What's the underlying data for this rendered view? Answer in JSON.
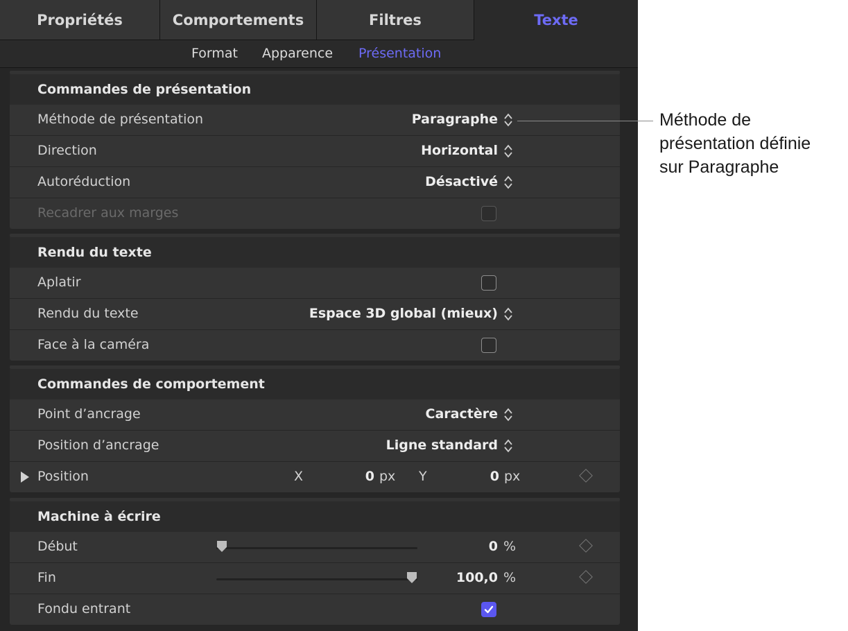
{
  "tabs": [
    {
      "label": "Propriétés"
    },
    {
      "label": "Comportements"
    },
    {
      "label": "Filtres"
    },
    {
      "label": "Texte"
    }
  ],
  "subtabs": [
    {
      "label": "Format"
    },
    {
      "label": "Apparence"
    },
    {
      "label": "Présentation"
    }
  ],
  "layout_controls": {
    "header": "Commandes de présentation",
    "method": {
      "label": "Méthode de présentation",
      "value": "Paragraphe"
    },
    "direction": {
      "label": "Direction",
      "value": "Horizontal"
    },
    "auto_shrink": {
      "label": "Autoréduction",
      "value": "Désactivé"
    },
    "reframe": {
      "label": "Recadrer aux marges",
      "checked": false
    }
  },
  "text_rendering": {
    "header": "Rendu du texte",
    "flatten": {
      "label": "Aplatir",
      "checked": false
    },
    "render": {
      "label": "Rendu du texte",
      "value": "Espace 3D global (mieux)"
    },
    "face_camera": {
      "label": "Face à la caméra",
      "checked": false
    }
  },
  "behavior_controls": {
    "header": "Commandes de comportement",
    "anchor_point": {
      "label": "Point d’ancrage",
      "value": "Caractère"
    },
    "anchor_position": {
      "label": "Position d’ancrage",
      "value": "Ligne standard"
    },
    "position": {
      "label": "Position",
      "x_label": "X",
      "x_value": "0",
      "x_unit": "px",
      "y_label": "Y",
      "y_value": "0",
      "y_unit": "px"
    }
  },
  "typewriter": {
    "header": "Machine à écrire",
    "start": {
      "label": "Début",
      "value": "0",
      "unit": "%",
      "slider_fraction": 0.0
    },
    "end": {
      "label": "Fin",
      "value": "100,0",
      "unit": "%",
      "slider_fraction": 1.0
    },
    "fade_in": {
      "label": "Fondu entrant",
      "checked": true
    }
  },
  "callout": {
    "line1": "Méthode de",
    "line2": "présentation définie",
    "line3": "sur Paragraphe"
  },
  "colors": {
    "accent": "#6d6bf5",
    "checkbox_checked": "#5b57f0",
    "panel_bg": "#262626",
    "row_bg": "#343434"
  }
}
